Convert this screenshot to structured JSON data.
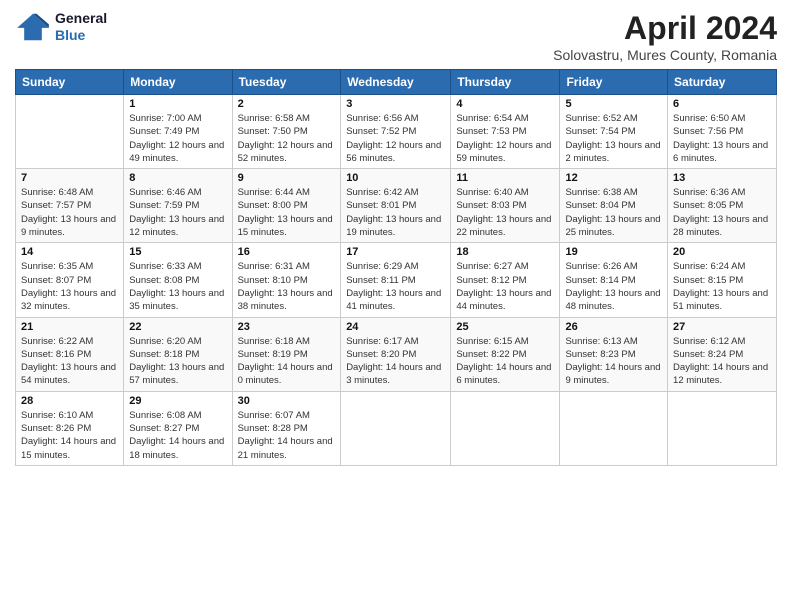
{
  "logo": {
    "line1": "General",
    "line2": "Blue"
  },
  "title": "April 2024",
  "subtitle": "Solovastru, Mures County, Romania",
  "header_days": [
    "Sunday",
    "Monday",
    "Tuesday",
    "Wednesday",
    "Thursday",
    "Friday",
    "Saturday"
  ],
  "weeks": [
    [
      {
        "day": "",
        "sunrise": "",
        "sunset": "",
        "daylight": ""
      },
      {
        "day": "1",
        "sunrise": "Sunrise: 7:00 AM",
        "sunset": "Sunset: 7:49 PM",
        "daylight": "Daylight: 12 hours and 49 minutes."
      },
      {
        "day": "2",
        "sunrise": "Sunrise: 6:58 AM",
        "sunset": "Sunset: 7:50 PM",
        "daylight": "Daylight: 12 hours and 52 minutes."
      },
      {
        "day": "3",
        "sunrise": "Sunrise: 6:56 AM",
        "sunset": "Sunset: 7:52 PM",
        "daylight": "Daylight: 12 hours and 56 minutes."
      },
      {
        "day": "4",
        "sunrise": "Sunrise: 6:54 AM",
        "sunset": "Sunset: 7:53 PM",
        "daylight": "Daylight: 12 hours and 59 minutes."
      },
      {
        "day": "5",
        "sunrise": "Sunrise: 6:52 AM",
        "sunset": "Sunset: 7:54 PM",
        "daylight": "Daylight: 13 hours and 2 minutes."
      },
      {
        "day": "6",
        "sunrise": "Sunrise: 6:50 AM",
        "sunset": "Sunset: 7:56 PM",
        "daylight": "Daylight: 13 hours and 6 minutes."
      }
    ],
    [
      {
        "day": "7",
        "sunrise": "Sunrise: 6:48 AM",
        "sunset": "Sunset: 7:57 PM",
        "daylight": "Daylight: 13 hours and 9 minutes."
      },
      {
        "day": "8",
        "sunrise": "Sunrise: 6:46 AM",
        "sunset": "Sunset: 7:59 PM",
        "daylight": "Daylight: 13 hours and 12 minutes."
      },
      {
        "day": "9",
        "sunrise": "Sunrise: 6:44 AM",
        "sunset": "Sunset: 8:00 PM",
        "daylight": "Daylight: 13 hours and 15 minutes."
      },
      {
        "day": "10",
        "sunrise": "Sunrise: 6:42 AM",
        "sunset": "Sunset: 8:01 PM",
        "daylight": "Daylight: 13 hours and 19 minutes."
      },
      {
        "day": "11",
        "sunrise": "Sunrise: 6:40 AM",
        "sunset": "Sunset: 8:03 PM",
        "daylight": "Daylight: 13 hours and 22 minutes."
      },
      {
        "day": "12",
        "sunrise": "Sunrise: 6:38 AM",
        "sunset": "Sunset: 8:04 PM",
        "daylight": "Daylight: 13 hours and 25 minutes."
      },
      {
        "day": "13",
        "sunrise": "Sunrise: 6:36 AM",
        "sunset": "Sunset: 8:05 PM",
        "daylight": "Daylight: 13 hours and 28 minutes."
      }
    ],
    [
      {
        "day": "14",
        "sunrise": "Sunrise: 6:35 AM",
        "sunset": "Sunset: 8:07 PM",
        "daylight": "Daylight: 13 hours and 32 minutes."
      },
      {
        "day": "15",
        "sunrise": "Sunrise: 6:33 AM",
        "sunset": "Sunset: 8:08 PM",
        "daylight": "Daylight: 13 hours and 35 minutes."
      },
      {
        "day": "16",
        "sunrise": "Sunrise: 6:31 AM",
        "sunset": "Sunset: 8:10 PM",
        "daylight": "Daylight: 13 hours and 38 minutes."
      },
      {
        "day": "17",
        "sunrise": "Sunrise: 6:29 AM",
        "sunset": "Sunset: 8:11 PM",
        "daylight": "Daylight: 13 hours and 41 minutes."
      },
      {
        "day": "18",
        "sunrise": "Sunrise: 6:27 AM",
        "sunset": "Sunset: 8:12 PM",
        "daylight": "Daylight: 13 hours and 44 minutes."
      },
      {
        "day": "19",
        "sunrise": "Sunrise: 6:26 AM",
        "sunset": "Sunset: 8:14 PM",
        "daylight": "Daylight: 13 hours and 48 minutes."
      },
      {
        "day": "20",
        "sunrise": "Sunrise: 6:24 AM",
        "sunset": "Sunset: 8:15 PM",
        "daylight": "Daylight: 13 hours and 51 minutes."
      }
    ],
    [
      {
        "day": "21",
        "sunrise": "Sunrise: 6:22 AM",
        "sunset": "Sunset: 8:16 PM",
        "daylight": "Daylight: 13 hours and 54 minutes."
      },
      {
        "day": "22",
        "sunrise": "Sunrise: 6:20 AM",
        "sunset": "Sunset: 8:18 PM",
        "daylight": "Daylight: 13 hours and 57 minutes."
      },
      {
        "day": "23",
        "sunrise": "Sunrise: 6:18 AM",
        "sunset": "Sunset: 8:19 PM",
        "daylight": "Daylight: 14 hours and 0 minutes."
      },
      {
        "day": "24",
        "sunrise": "Sunrise: 6:17 AM",
        "sunset": "Sunset: 8:20 PM",
        "daylight": "Daylight: 14 hours and 3 minutes."
      },
      {
        "day": "25",
        "sunrise": "Sunrise: 6:15 AM",
        "sunset": "Sunset: 8:22 PM",
        "daylight": "Daylight: 14 hours and 6 minutes."
      },
      {
        "day": "26",
        "sunrise": "Sunrise: 6:13 AM",
        "sunset": "Sunset: 8:23 PM",
        "daylight": "Daylight: 14 hours and 9 minutes."
      },
      {
        "day": "27",
        "sunrise": "Sunrise: 6:12 AM",
        "sunset": "Sunset: 8:24 PM",
        "daylight": "Daylight: 14 hours and 12 minutes."
      }
    ],
    [
      {
        "day": "28",
        "sunrise": "Sunrise: 6:10 AM",
        "sunset": "Sunset: 8:26 PM",
        "daylight": "Daylight: 14 hours and 15 minutes."
      },
      {
        "day": "29",
        "sunrise": "Sunrise: 6:08 AM",
        "sunset": "Sunset: 8:27 PM",
        "daylight": "Daylight: 14 hours and 18 minutes."
      },
      {
        "day": "30",
        "sunrise": "Sunrise: 6:07 AM",
        "sunset": "Sunset: 8:28 PM",
        "daylight": "Daylight: 14 hours and 21 minutes."
      },
      {
        "day": "",
        "sunrise": "",
        "sunset": "",
        "daylight": ""
      },
      {
        "day": "",
        "sunrise": "",
        "sunset": "",
        "daylight": ""
      },
      {
        "day": "",
        "sunrise": "",
        "sunset": "",
        "daylight": ""
      },
      {
        "day": "",
        "sunrise": "",
        "sunset": "",
        "daylight": ""
      }
    ]
  ]
}
